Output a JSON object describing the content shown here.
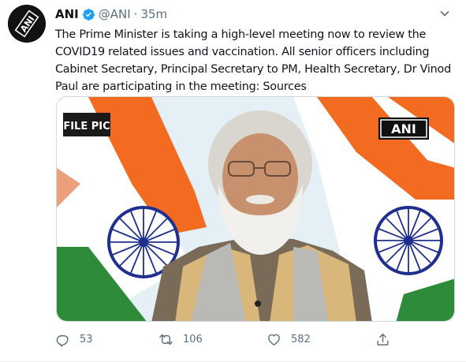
{
  "tweet": {
    "author_name": "ANI",
    "author_handle": "@ANI",
    "separator": "·",
    "time_ago": "35m",
    "text": "The Prime Minister is taking a high-level meeting now to review the COVID19 related issues and vaccination. All senior officers including Cabinet Secretary, Principal Secretary to PM, Health Secretary, Dr Vinod Paul are participating in the meeting: Sources",
    "media": {
      "badge_left": "FILE PIC",
      "badge_right": "ANI"
    },
    "stats": {
      "replies": "53",
      "retweets": "106",
      "likes": "582"
    }
  },
  "colors": {
    "verified": "#1da1f2",
    "secondary_text": "#5b7083",
    "saffron": "#f26b21",
    "green": "#2e8b3a",
    "chakra": "#1f2f8f"
  },
  "icons": {
    "avatar": "ani-logo",
    "verified": "verified-badge-icon",
    "more": "chevron-down-icon",
    "reply": "reply-icon",
    "retweet": "retweet-icon",
    "like": "heart-icon",
    "share": "share-icon"
  }
}
